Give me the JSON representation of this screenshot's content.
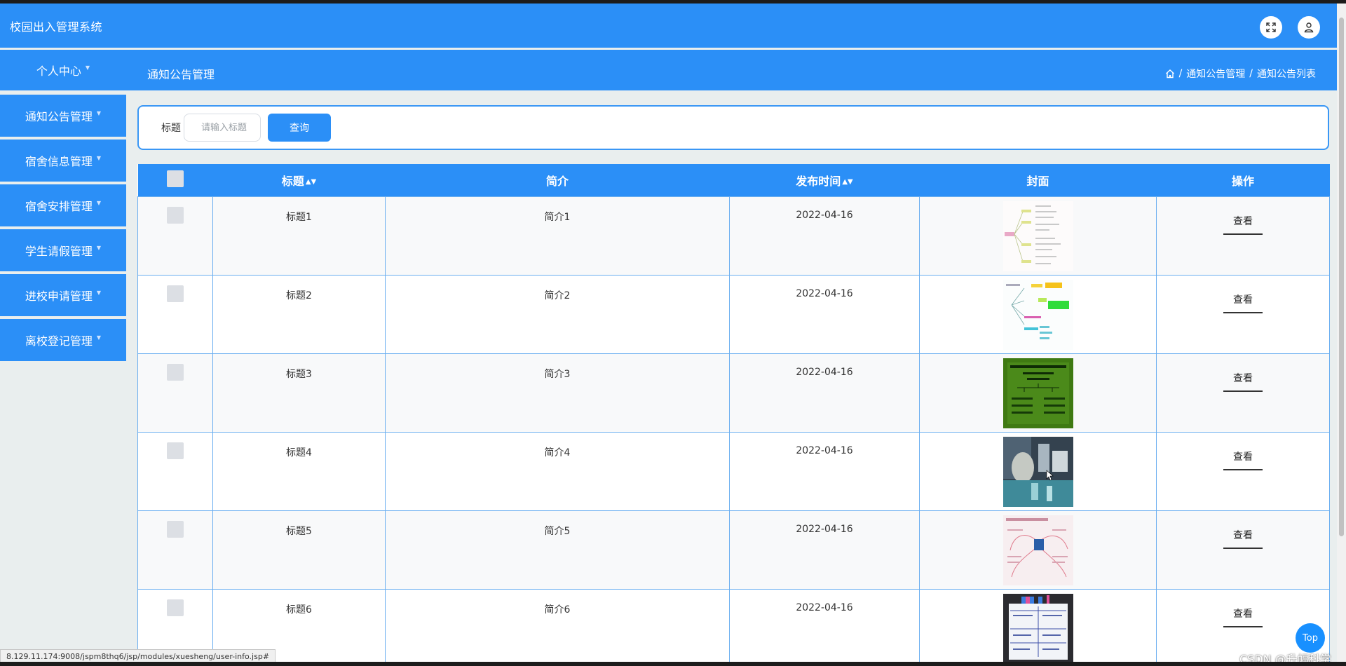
{
  "header": {
    "app_title": "校园出入管理系统",
    "fullscreen_icon": "fullscreen-icon",
    "user_icon": "user-icon"
  },
  "sidebar": {
    "items": [
      {
        "label": "个人中心"
      },
      {
        "label": "通知公告管理"
      },
      {
        "label": "宿舍信息管理"
      },
      {
        "label": "宿舍安排管理"
      },
      {
        "label": "学生请假管理"
      },
      {
        "label": "进校申请管理"
      },
      {
        "label": "离校登记管理"
      }
    ]
  },
  "subheader": {
    "page_title": "通知公告管理",
    "breadcrumb": [
      "通知公告管理",
      "通知公告列表"
    ],
    "separator": "/"
  },
  "search": {
    "label": "标题",
    "placeholder": "请输入标题",
    "button_label": "查询"
  },
  "table": {
    "columns": [
      "标题",
      "简介",
      "发布时间",
      "封面",
      "操作"
    ],
    "rows": [
      {
        "title": "标题1",
        "intro": "简介1",
        "date": "2022-04-16",
        "action": "查看"
      },
      {
        "title": "标题2",
        "intro": "简介2",
        "date": "2022-04-16",
        "action": "查看"
      },
      {
        "title": "标题3",
        "intro": "简介3",
        "date": "2022-04-16",
        "action": "查看"
      },
      {
        "title": "标题4",
        "intro": "简介4",
        "date": "2022-04-16",
        "action": "查看"
      },
      {
        "title": "标题5",
        "intro": "简介5",
        "date": "2022-04-16",
        "action": "查看"
      },
      {
        "title": "标题6",
        "intro": "简介6",
        "date": "2022-04-16",
        "action": "查看"
      }
    ]
  },
  "statusbar": {
    "url": "8.129.11.174:9008/jspm8thq6/jsp/modules/xuesheng/user-info.jsp#"
  },
  "overlay": {
    "top_button": "Top",
    "watermark": "CSDN @升幅科学"
  },
  "colors": {
    "primary": "#2b8ff7",
    "background": "#e9eeee"
  }
}
